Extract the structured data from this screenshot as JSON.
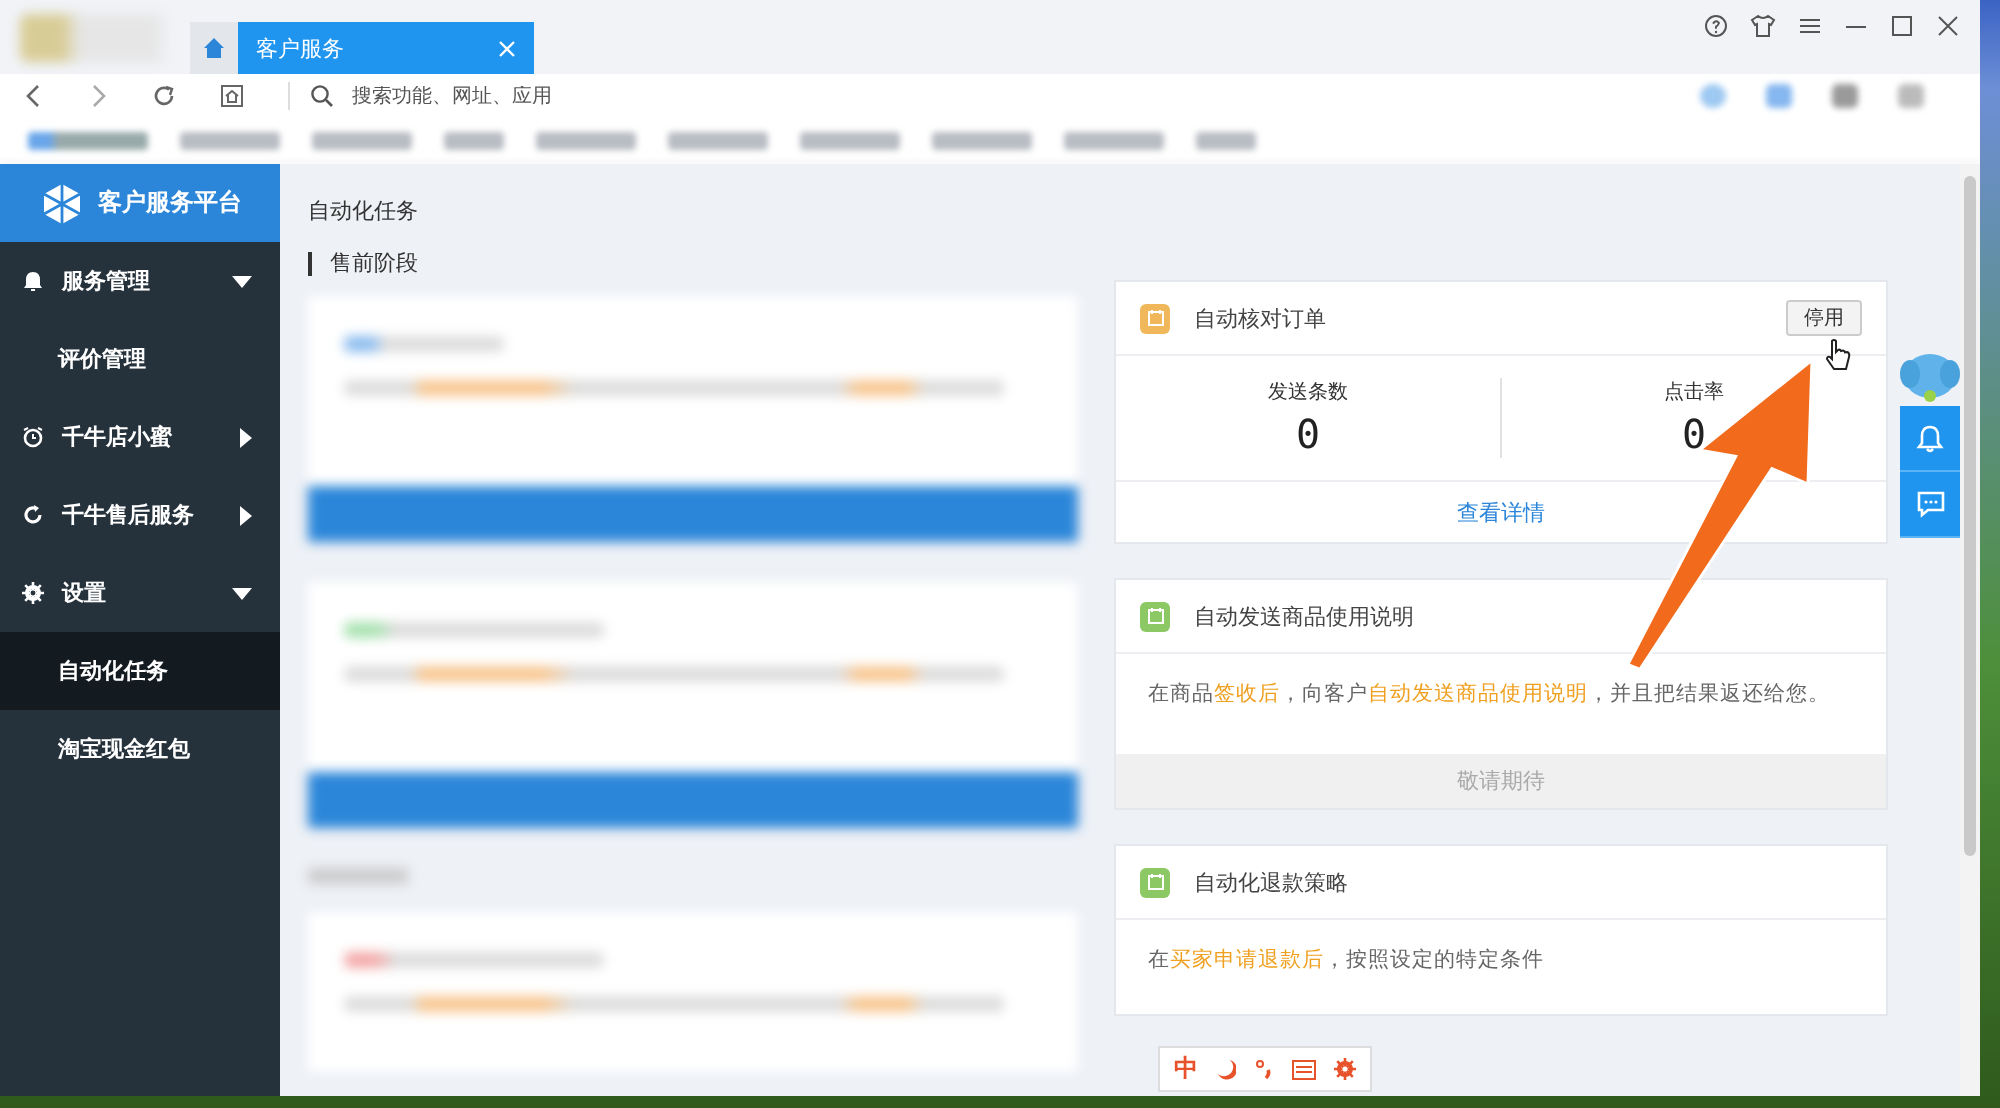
{
  "window": {
    "tabs": [
      {
        "kind": "home",
        "selected": false
      },
      {
        "kind": "page",
        "label": "客户服务",
        "selected": true
      }
    ],
    "address": {
      "placeholder": "搜索功能、网址、应用"
    }
  },
  "sidebar": {
    "title": "客户服务平台",
    "items": [
      {
        "label": "服务管理",
        "expanded": true,
        "children": [
          {
            "label": "评价管理",
            "selected": false
          }
        ]
      },
      {
        "label": "千牛店小蜜",
        "expanded": false
      },
      {
        "label": "千牛售后服务",
        "expanded": false
      },
      {
        "label": "设置",
        "expanded": true,
        "children": [
          {
            "label": "自动化任务",
            "selected": true
          },
          {
            "label": "淘宝现金红包",
            "selected": false
          }
        ]
      }
    ]
  },
  "content": {
    "breadcrumb": "自动化任务",
    "section_title": "售前阶段",
    "cards": [
      {
        "kind": "stats",
        "title": "自动核对订单",
        "color": "#f0b85a",
        "button": "停用",
        "stats": [
          {
            "label": "发送条数",
            "value": "0"
          },
          {
            "label": "点击率",
            "value": "0"
          }
        ],
        "link": "查看详情"
      },
      {
        "kind": "description",
        "title": "自动发送商品使用说明",
        "color": "#8cc864",
        "text": "在商品**签收后**，向客户**自动发送商品使用说明**，并且把结果返还给您。",
        "footer": {
          "label": "敬请期待",
          "disabled": true
        }
      },
      {
        "kind": "description",
        "title": "自动化退款策略",
        "color": "#8cc864",
        "text": "在**买家申请退款后**，按照设定的特定条件"
      }
    ]
  },
  "ime_bar": {
    "label": "中"
  }
}
